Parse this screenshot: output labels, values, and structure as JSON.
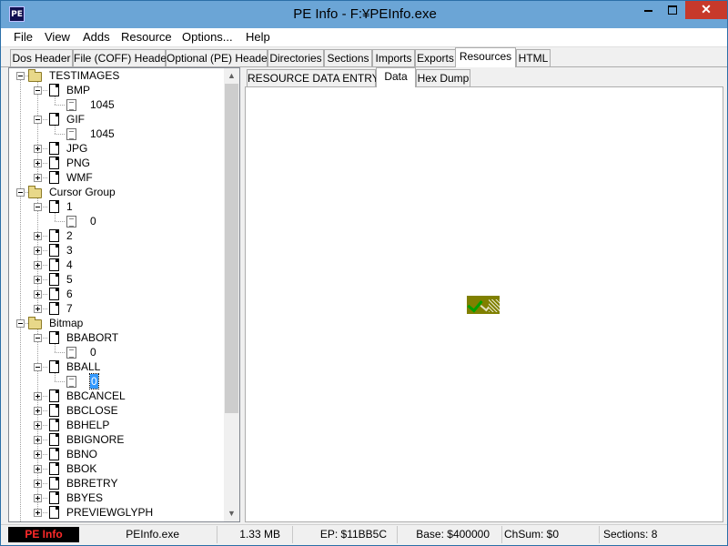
{
  "window": {
    "title": "PE Info - F:¥PEInfo.exe",
    "app_icon_text": "PE",
    "minimize_glyph": "",
    "close_glyph": "✕"
  },
  "menu": [
    "File",
    "View",
    "Adds",
    "Resource",
    "Options...",
    "Help"
  ],
  "tabs": [
    "Dos Header",
    "File (COFF) Header",
    "Optional (PE) Header",
    "Directories",
    "Sections",
    "Imports",
    "Exports",
    "Resources",
    "HTML"
  ],
  "active_tab": "Resources",
  "tree": {
    "nodes": [
      {
        "label": "TESTIMAGES",
        "kind": "folder",
        "level": 0,
        "state": "expanded"
      },
      {
        "label": "BMP",
        "kind": "doc",
        "level": 1,
        "state": "expanded"
      },
      {
        "label": "1045",
        "kind": "res",
        "level": 2,
        "state": "leaf"
      },
      {
        "label": "GIF",
        "kind": "doc",
        "level": 1,
        "state": "expanded"
      },
      {
        "label": "1045",
        "kind": "res",
        "level": 2,
        "state": "leaf"
      },
      {
        "label": "JPG",
        "kind": "doc",
        "level": 1,
        "state": "collapsed"
      },
      {
        "label": "PNG",
        "kind": "doc",
        "level": 1,
        "state": "collapsed"
      },
      {
        "label": "WMF",
        "kind": "doc",
        "level": 1,
        "state": "collapsed"
      },
      {
        "label": "Cursor Group",
        "kind": "folder",
        "level": 0,
        "state": "expanded"
      },
      {
        "label": "1",
        "kind": "doc",
        "level": 1,
        "state": "expanded"
      },
      {
        "label": "0",
        "kind": "res",
        "level": 2,
        "state": "leaf"
      },
      {
        "label": "2",
        "kind": "doc",
        "level": 1,
        "state": "collapsed"
      },
      {
        "label": "3",
        "kind": "doc",
        "level": 1,
        "state": "collapsed"
      },
      {
        "label": "4",
        "kind": "doc",
        "level": 1,
        "state": "collapsed"
      },
      {
        "label": "5",
        "kind": "doc",
        "level": 1,
        "state": "collapsed"
      },
      {
        "label": "6",
        "kind": "doc",
        "level": 1,
        "state": "collapsed"
      },
      {
        "label": "7",
        "kind": "doc",
        "level": 1,
        "state": "collapsed"
      },
      {
        "label": "Bitmap",
        "kind": "folder",
        "level": 0,
        "state": "expanded"
      },
      {
        "label": "BBABORT",
        "kind": "doc",
        "level": 1,
        "state": "expanded"
      },
      {
        "label": "0",
        "kind": "res",
        "level": 2,
        "state": "leaf"
      },
      {
        "label": "BBALL",
        "kind": "doc",
        "level": 1,
        "state": "expanded"
      },
      {
        "label": "0",
        "kind": "res",
        "level": 2,
        "state": "leaf",
        "selected": true
      },
      {
        "label": "BBCANCEL",
        "kind": "doc",
        "level": 1,
        "state": "collapsed"
      },
      {
        "label": "BBCLOSE",
        "kind": "doc",
        "level": 1,
        "state": "collapsed"
      },
      {
        "label": "BBHELP",
        "kind": "doc",
        "level": 1,
        "state": "collapsed"
      },
      {
        "label": "BBIGNORE",
        "kind": "doc",
        "level": 1,
        "state": "collapsed"
      },
      {
        "label": "BBNO",
        "kind": "doc",
        "level": 1,
        "state": "collapsed"
      },
      {
        "label": "BBOK",
        "kind": "doc",
        "level": 1,
        "state": "collapsed"
      },
      {
        "label": "BBRETRY",
        "kind": "doc",
        "level": 1,
        "state": "collapsed"
      },
      {
        "label": "BBYES",
        "kind": "doc",
        "level": 1,
        "state": "collapsed"
      },
      {
        "label": "PREVIEWGLYPH",
        "kind": "doc",
        "level": 1,
        "state": "collapsed"
      }
    ],
    "scroll_up_glyph": "▲",
    "scroll_down_glyph": "▼"
  },
  "subtabs": [
    "RESOURCE DATA ENTRY",
    "Data",
    "Hex Dump"
  ],
  "active_subtab": "Data",
  "status": {
    "brand": "PE Info",
    "file": "PEInfo.exe",
    "size": "1.33 MB",
    "ep": "EP: $11BB5C",
    "base": "Base: $400000",
    "checksum": "ChSum: $0",
    "sections": "Sections: 8"
  }
}
